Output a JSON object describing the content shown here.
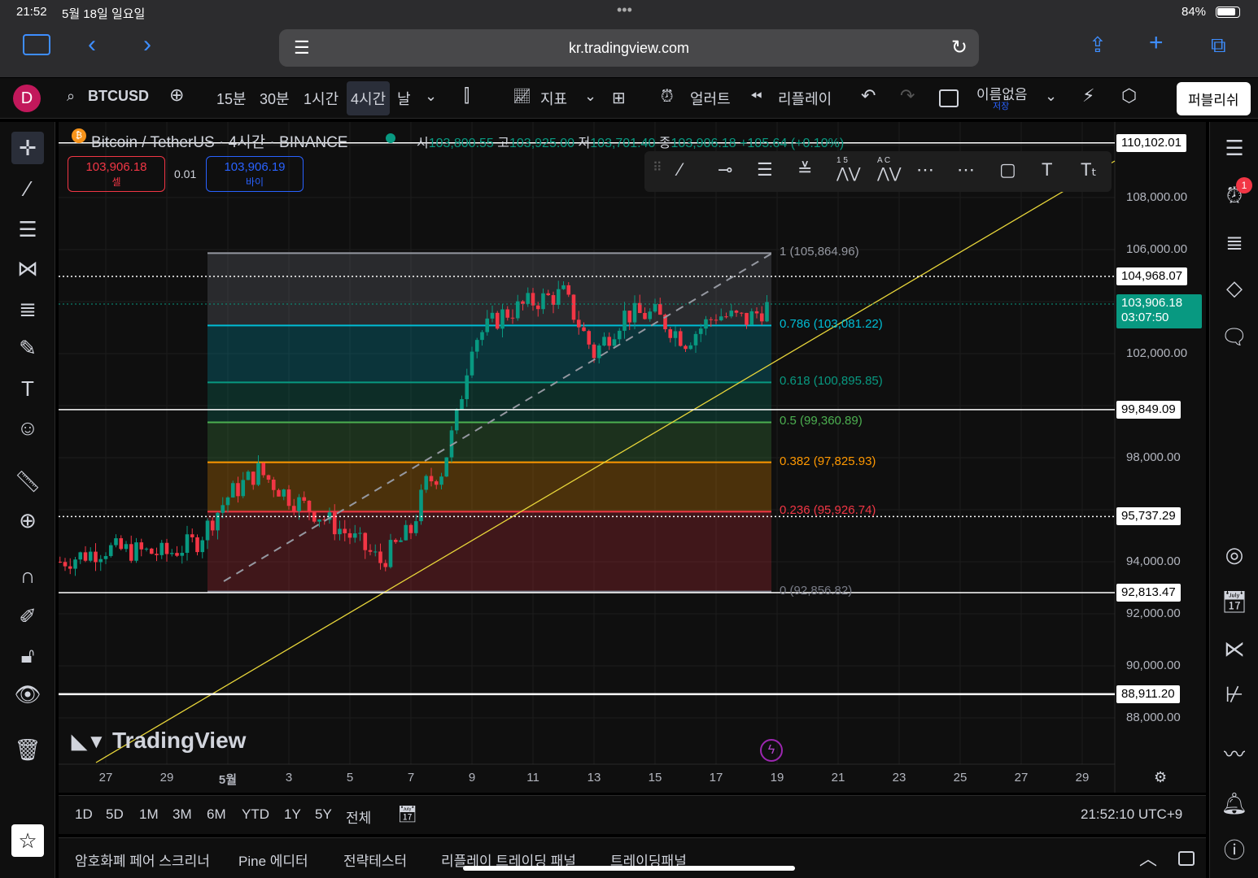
{
  "status": {
    "time": "21:52",
    "date": "5월 18일 일요일",
    "battery": "84%",
    "dots": "•••"
  },
  "browser": {
    "url": "kr.tradingview.com"
  },
  "toolbar": {
    "avatar": "D",
    "symbol": "BTCUSD",
    "intervals": [
      "15분",
      "30분",
      "1시간",
      "4시간",
      "날"
    ],
    "active_interval": "4시간",
    "indicators": "지표",
    "alert": "얼러트",
    "replay": "리플레이",
    "layout_name": "이름없음",
    "layout_sub": "저장",
    "publish": "퍼블리쉬"
  },
  "legend": {
    "title": "Bitcoin / TetherUS · 4시간 · BINANCE",
    "o_label": "시",
    "o": "103,800.55",
    "h_label": "고",
    "h": "103,925.00",
    "l_label": "저",
    "l": "103,701.40",
    "c_label": "종",
    "c": "103,906.18",
    "change": "+105.64 (+0.10%)"
  },
  "trade": {
    "sell_price": "103,906.18",
    "sell_label": "셀",
    "spread": "0.01",
    "buy_price": "103,906.19",
    "buy_label": "바이"
  },
  "drawing_toolbar": {
    "fib_labels": "1 5",
    "ac_labels": "A C"
  },
  "price_axis": {
    "ticks": [
      "108,000.00",
      "106,000.00",
      "102,000.00",
      "98,000.00",
      "94,000.00",
      "92,000.00",
      "90,000.00",
      "88,000.00"
    ],
    "lines": [
      {
        "label": "110,102.01",
        "price": 110102.01,
        "style": "solid"
      },
      {
        "label": "104,968.07",
        "price": 104968.07,
        "style": "dotted"
      },
      {
        "label": "99,849.09",
        "price": 99849.09,
        "style": "solid"
      },
      {
        "label": "95,737.29",
        "price": 95737.29,
        "style": "dotted"
      },
      {
        "label": "92,813.47",
        "price": 92813.47,
        "style": "solid"
      },
      {
        "label": "88,911.20",
        "price": 88911.2,
        "style": "solid"
      }
    ],
    "current": {
      "price": "103,906.18",
      "countdown": "03:07:50",
      "value": 103906.18,
      "color": "#089981"
    }
  },
  "fib": [
    {
      "label": "1 (105,864.96)",
      "value": 105864.96,
      "color": "#9598a1"
    },
    {
      "label": "0.786 (103,081.22)",
      "value": 103081.22,
      "color": "#00bcd4"
    },
    {
      "label": "0.618 (100,895.85)",
      "value": 100895.85,
      "color": "#089981"
    },
    {
      "label": "0.5 (99,360.89)",
      "value": 99360.89,
      "color": "#4caf50"
    },
    {
      "label": "0.382 (97,825.93)",
      "value": 97825.93,
      "color": "#ff9800"
    },
    {
      "label": "0.236 (95,926.74)",
      "value": 95926.74,
      "color": "#f23645"
    },
    {
      "label": "0 (92,856.82)",
      "value": 92856.82,
      "color": "#787b86"
    }
  ],
  "time_axis": [
    "27",
    "29",
    "5월",
    "3",
    "5",
    "7",
    "9",
    "11",
    "13",
    "15",
    "17",
    "19",
    "21",
    "23",
    "25",
    "27",
    "29"
  ],
  "chart_data": {
    "type": "candlestick",
    "interval": "4h",
    "ylim": [
      87000,
      111000
    ],
    "path_days_from_may1": [
      -5.5,
      -4,
      -2,
      -1,
      0,
      1,
      2,
      3,
      4,
      5,
      6,
      6.5,
      7,
      7.5,
      8,
      9,
      10,
      11,
      12,
      13,
      14,
      15,
      16,
      17,
      17.8
    ],
    "path_prices": [
      94000,
      94500,
      94300,
      94800,
      96500,
      97500,
      96500,
      95800,
      95000,
      94000,
      95200,
      97000,
      97500,
      99500,
      102500,
      103500,
      104000,
      104300,
      102000,
      103500,
      103500,
      102500,
      103500,
      103300,
      103900
    ]
  },
  "watermark": "TradingView",
  "range": {
    "buttons": [
      "1D",
      "5D",
      "1M",
      "3M",
      "6M",
      "YTD",
      "1Y",
      "5Y",
      "전체"
    ],
    "clock": "21:52:10 UTC+9"
  },
  "panel": {
    "tabs": [
      "암호화폐 페어 스크리너",
      "Pine 에디터",
      "전략테스터",
      "리플레이 트레이딩 패널",
      "트레이딩패널"
    ]
  },
  "sidebar_badge": "1"
}
